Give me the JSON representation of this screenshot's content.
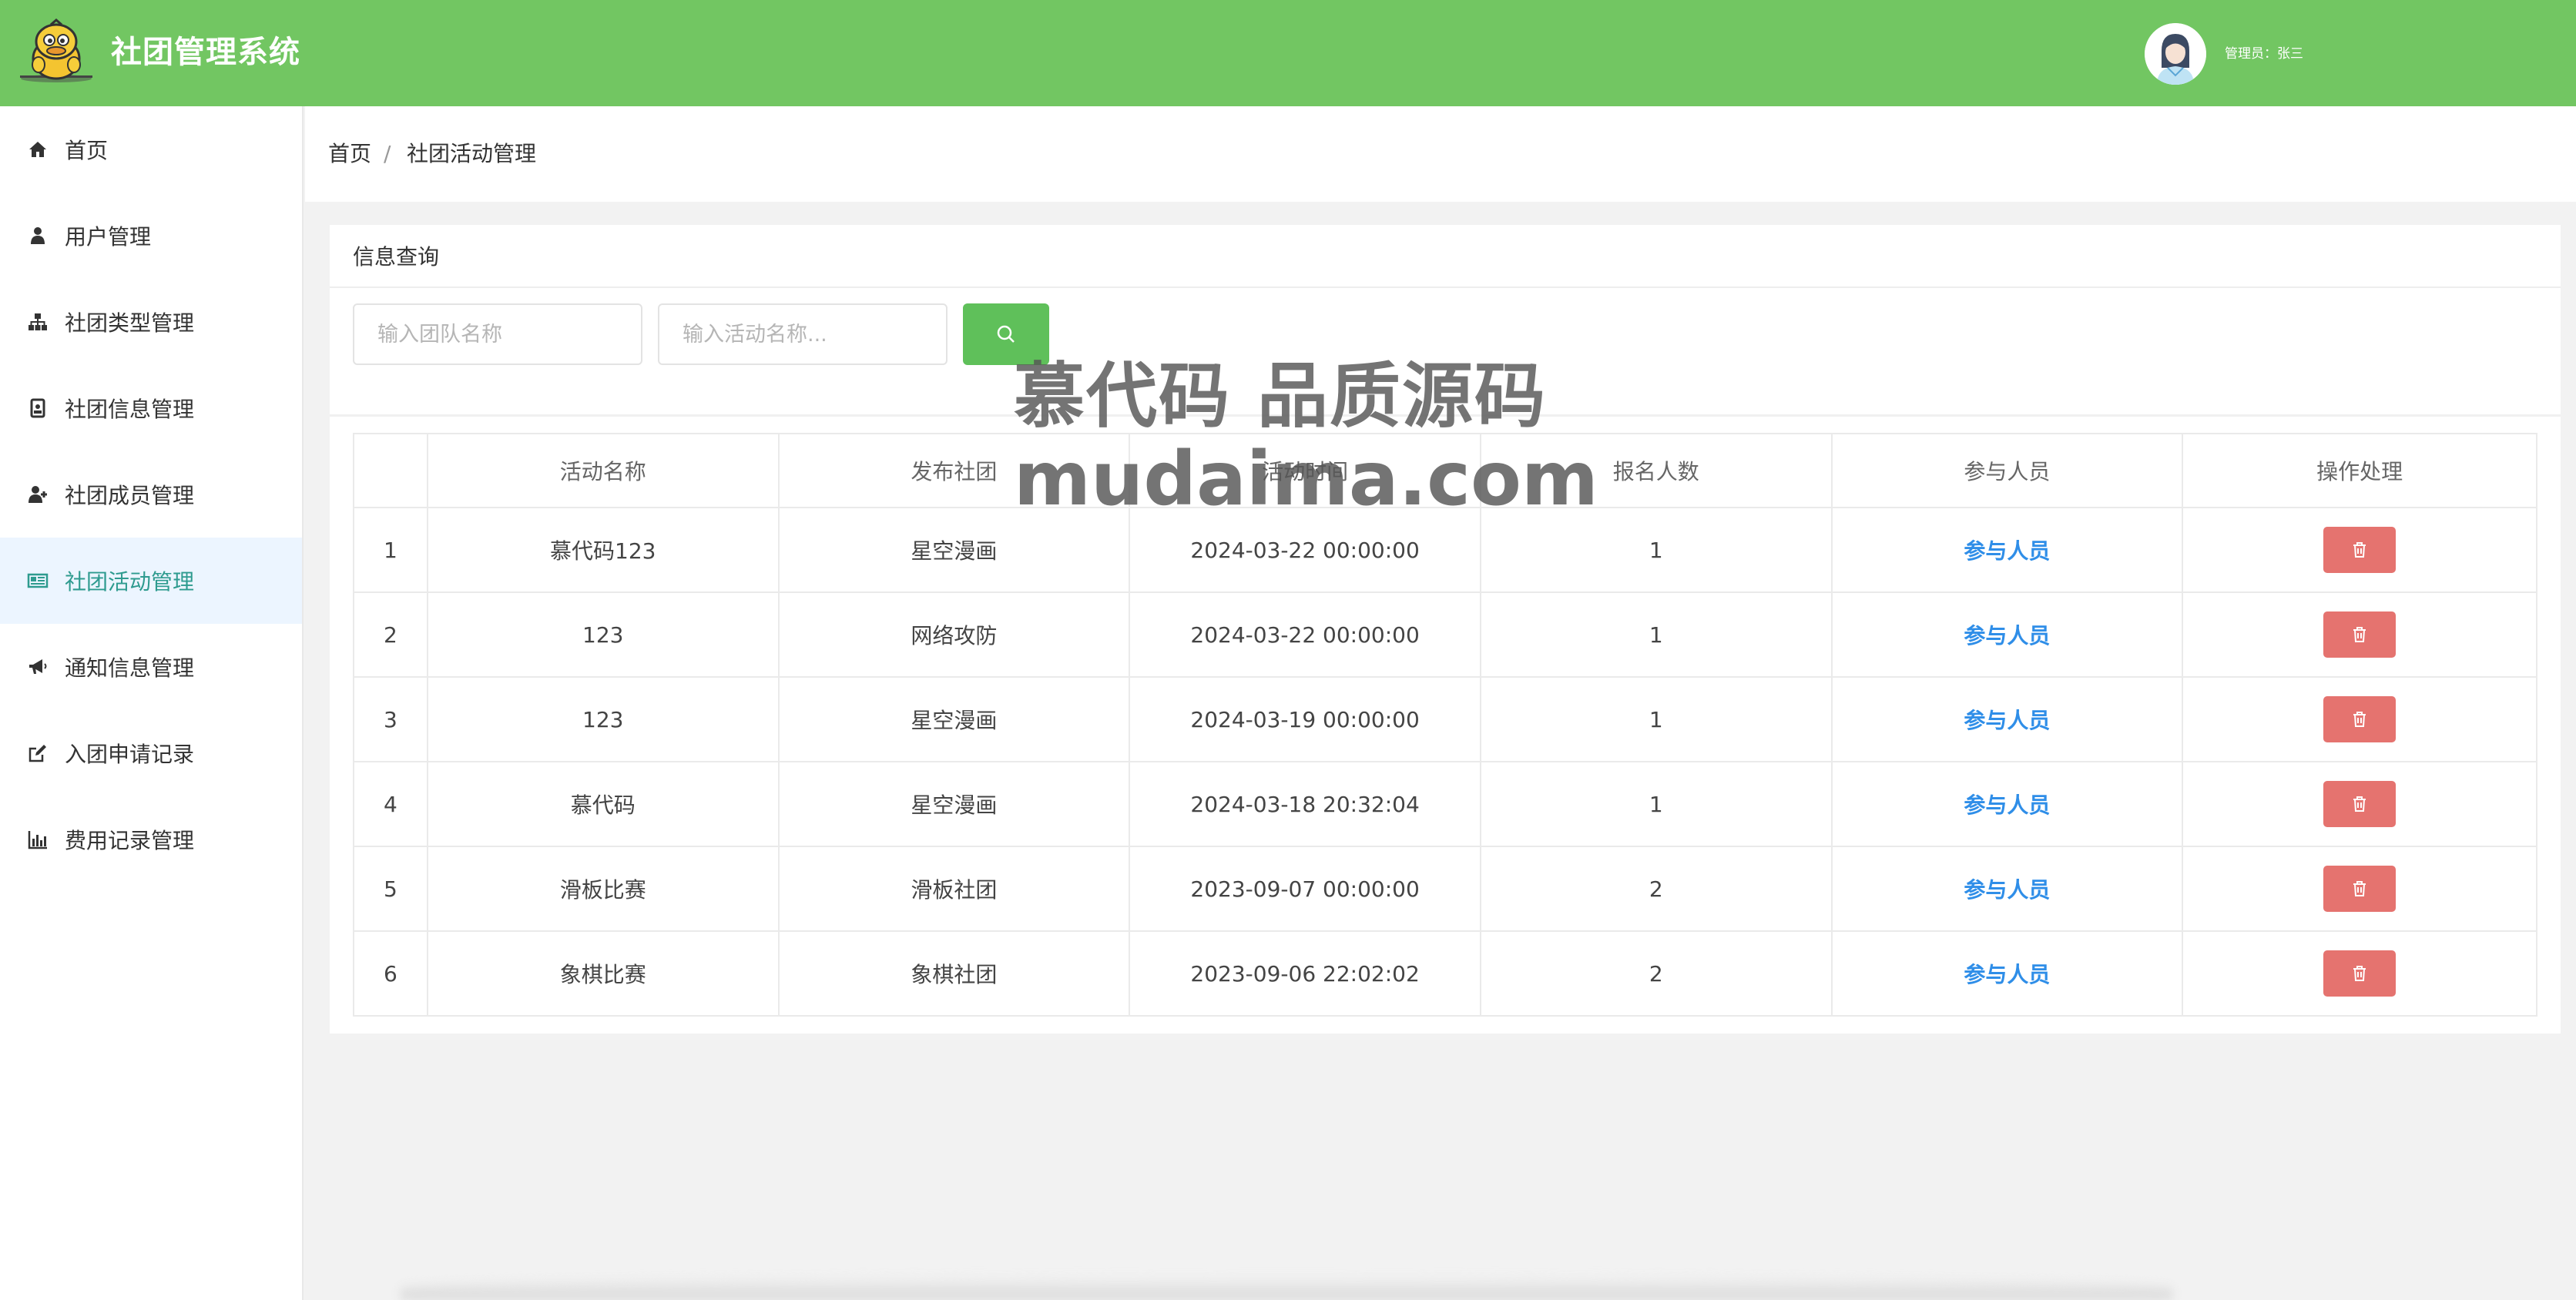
{
  "header": {
    "app_title": "社团管理系统",
    "user_label": "管理员：张三",
    "bg_color": "#72c662"
  },
  "sidebar": {
    "items": [
      {
        "label": "首页",
        "icon": "home-icon"
      },
      {
        "label": "用户管理",
        "icon": "user-icon"
      },
      {
        "label": "社团类型管理",
        "icon": "sitemap-icon"
      },
      {
        "label": "社团信息管理",
        "icon": "id-card-icon"
      },
      {
        "label": "社团成员管理",
        "icon": "user-plus-icon"
      },
      {
        "label": "社团活动管理",
        "icon": "newspaper-icon",
        "active": true
      },
      {
        "label": "通知信息管理",
        "icon": "bullhorn-icon"
      },
      {
        "label": "入团申请记录",
        "icon": "edit-icon"
      },
      {
        "label": "费用记录管理",
        "icon": "bar-chart-icon"
      }
    ]
  },
  "breadcrumb": {
    "home": "首页",
    "separator": "/",
    "current": "社团活动管理"
  },
  "query": {
    "title": "信息查询",
    "team_placeholder": "输入团队名称",
    "activity_placeholder": "输入活动名称..."
  },
  "table": {
    "columns": [
      "",
      "活动名称",
      "发布社团",
      "活动时间",
      "报名人数",
      "参与人员",
      "操作处理"
    ],
    "rows": [
      {
        "index": "1",
        "name": "慕代码123",
        "club": "星空漫画",
        "time": "2024-03-22 00:00:00",
        "count": "1",
        "participants": "参与人员"
      },
      {
        "index": "2",
        "name": "123",
        "club": "网络攻防",
        "time": "2024-03-22 00:00:00",
        "count": "1",
        "participants": "参与人员"
      },
      {
        "index": "3",
        "name": "123",
        "club": "星空漫画",
        "time": "2024-03-19 00:00:00",
        "count": "1",
        "participants": "参与人员"
      },
      {
        "index": "4",
        "name": "慕代码",
        "club": "星空漫画",
        "time": "2024-03-18 20:32:04",
        "count": "1",
        "participants": "参与人员"
      },
      {
        "index": "5",
        "name": "滑板比赛",
        "club": "滑板社团",
        "time": "2023-09-07 00:00:00",
        "count": "2",
        "participants": "参与人员"
      },
      {
        "index": "6",
        "name": "象棋比赛",
        "club": "象棋社团",
        "time": "2023-09-06 22:02:02",
        "count": "2",
        "participants": "参与人员"
      }
    ]
  },
  "watermark": {
    "line1": "慕代码 品质源码",
    "line2": "mudaima.com"
  },
  "colors": {
    "accent_green": "#5fc05a",
    "link_blue": "#2f8ee8",
    "delete_red": "#e5736f",
    "active_menu_bg": "#ecf5ff"
  }
}
